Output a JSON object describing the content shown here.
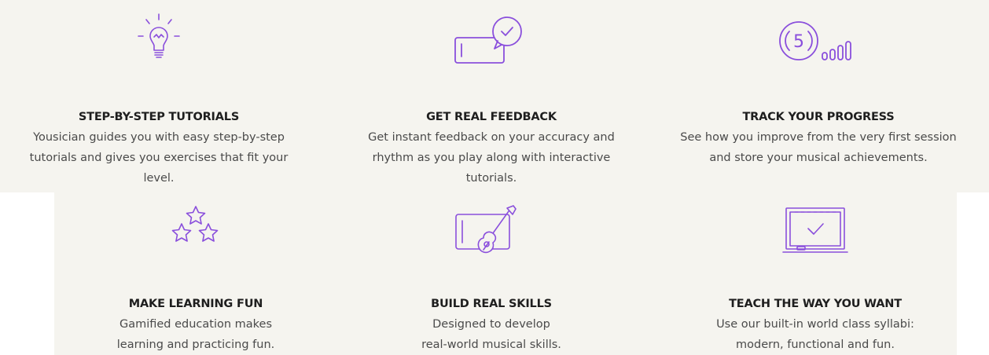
{
  "accent_color": "#8a4fdc",
  "features": [
    {
      "icon": "lightbulb-icon",
      "title": "STEP-BY-STEP TUTORIALS",
      "lines": [
        "Yousician guides you with easy step-by-step",
        "tutorials and gives you exercises that fit your",
        "level."
      ]
    },
    {
      "icon": "phone-feedback-icon",
      "title": "GET REAL FEEDBACK",
      "lines": [
        "Get instant feedback on your accuracy and",
        "rhythm as you play along with interactive",
        "tutorials."
      ]
    },
    {
      "icon": "progress-timer-icon",
      "icon_number": "5",
      "title": "TRACK YOUR PROGRESS",
      "lines": [
        "See how you improve from the very first session",
        "and store your musical achievements."
      ]
    },
    {
      "icon": "stars-icon",
      "title": "MAKE LEARNING FUN",
      "lines": [
        "Gamified education makes",
        "learning and practicing fun."
      ]
    },
    {
      "icon": "tablet-guitar-icon",
      "title": "BUILD REAL SKILLS",
      "lines": [
        "Designed to develop",
        "real-world musical skills."
      ]
    },
    {
      "icon": "chalkboard-icon",
      "title": "TEACH THE WAY YOU WANT",
      "lines": [
        "Use our built-in world class syllabi:",
        "modern, functional and fun."
      ]
    }
  ]
}
